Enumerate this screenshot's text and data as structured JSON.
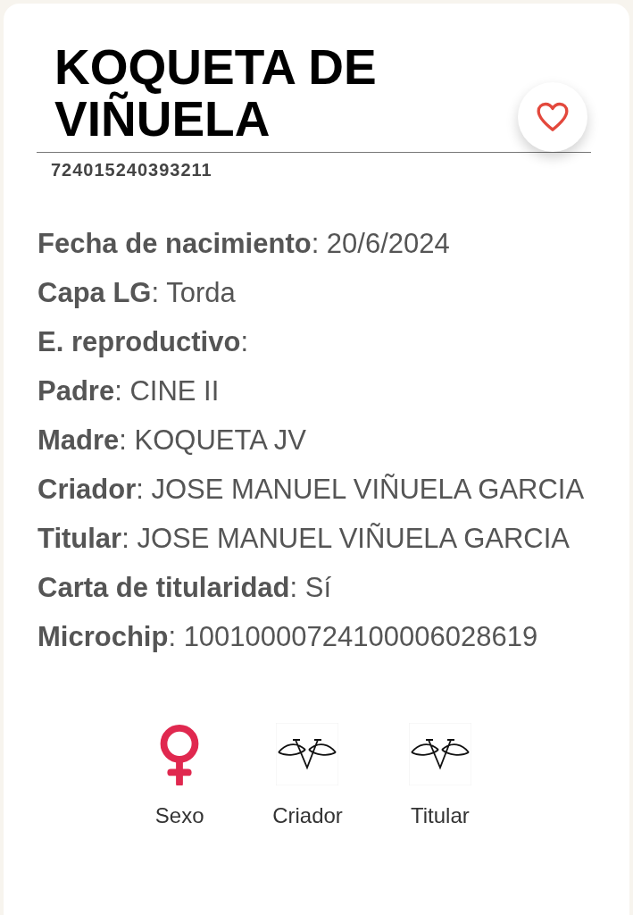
{
  "title": "KOQUETA DE VIÑUELA",
  "code": "724015240393211",
  "favorite": false,
  "fields": [
    {
      "text": "**Fecha de nacimiento**: 20/6/2024"
    },
    {
      "text": "**Capa LG**: Torda"
    },
    {
      "text": "**E. reproductivo**:"
    },
    {
      "text": "**Padre**: CINE II"
    },
    {
      "text": "**Madre**: KOQUETA JV"
    },
    {
      "text": "**Criador**: JOSE MANUEL VIÑUELA GARCIA"
    },
    {
      "text": "**Titular**: JOSE MANUEL VIÑUELA GARCIA"
    },
    {
      "text": "**Carta de titularidad**: Sí"
    },
    {
      "text": "**Microchip**: 10010000724100006028619"
    }
  ],
  "badges": [
    {
      "kind": "sex",
      "label": "Sexo"
    },
    {
      "kind": "brand",
      "label": "Criador"
    },
    {
      "kind": "brand",
      "label": "Titular"
    }
  ]
}
